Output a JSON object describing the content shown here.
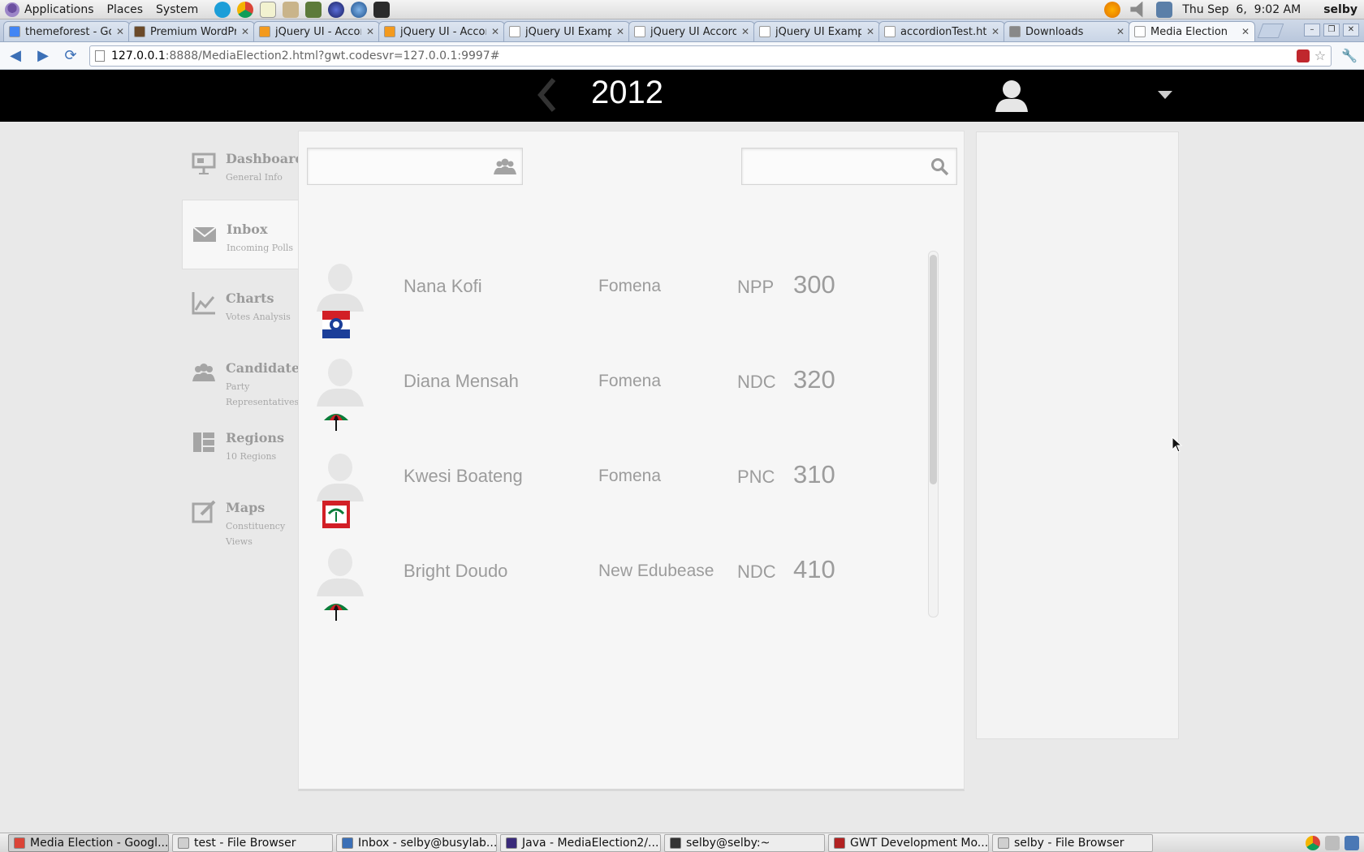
{
  "desktop": {
    "menus": [
      "Applications",
      "Places",
      "System"
    ],
    "clock": "Thu Sep  6,  9:02 AM",
    "user": "selby"
  },
  "browser": {
    "tabs": [
      {
        "label": "themeforest - Goo",
        "fav": "#4285f4"
      },
      {
        "label": "Premium WordPr",
        "fav": "#6b4a2a"
      },
      {
        "label": "jQuery UI - Accor",
        "fav": "#f39a1e"
      },
      {
        "label": "jQuery UI - Accor",
        "fav": "#f39a1e"
      },
      {
        "label": "jQuery UI Exampl",
        "fav": "#ffffff"
      },
      {
        "label": "jQuery UI Accord",
        "fav": "#ffffff"
      },
      {
        "label": "jQuery UI Examp",
        "fav": "#ffffff"
      },
      {
        "label": "accordionTest.htm",
        "fav": "#ffffff"
      },
      {
        "label": "Downloads",
        "fav": "#888888"
      },
      {
        "label": "Media Election",
        "fav": "#ffffff"
      }
    ],
    "url_host": "127.0.0.1",
    "url_rest": ":8888/MediaElection2.html?gwt.codesvr=127.0.0.1:9997#"
  },
  "app": {
    "year": "2012",
    "nav": [
      {
        "title": "Dashboard",
        "subtitle": "General Info"
      },
      {
        "title": "Inbox",
        "subtitle": "Incoming Polls"
      },
      {
        "title": "Charts",
        "subtitle": "Votes Analysis"
      },
      {
        "title": "Candidates",
        "subtitle": "Party Representatives"
      },
      {
        "title": "Regions",
        "subtitle": "10 Regions"
      },
      {
        "title": "Maps",
        "subtitle": "Constituency Views"
      }
    ],
    "active_nav": "Inbox",
    "candidates": [
      {
        "name": "Nana Kofi",
        "constituency": "Fomena",
        "party": "NPP",
        "votes": "300"
      },
      {
        "name": "Diana Mensah",
        "constituency": "Fomena",
        "party": "NDC",
        "votes": "320"
      },
      {
        "name": "Kwesi Boateng",
        "constituency": "Fomena",
        "party": "PNC",
        "votes": "310"
      },
      {
        "name": "Bright Doudo",
        "constituency": "New Edubease",
        "party": "NDC",
        "votes": "410"
      }
    ]
  },
  "taskbar": [
    "Media Election - Googl...",
    "test - File Browser",
    "Inbox - selby@busylab...",
    "Java - MediaElection2/...",
    "selby@selby:~",
    "GWT Development Mo...",
    "selby - File Browser"
  ]
}
